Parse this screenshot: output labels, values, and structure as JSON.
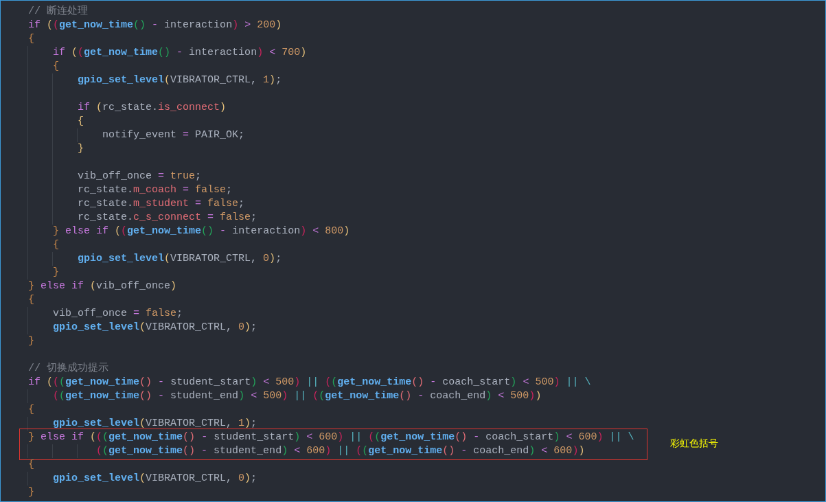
{
  "editor": {
    "lines": [
      {
        "kind": "code",
        "tokens": [
          {
            "kind": "cmt",
            "text": "// 断连处理"
          }
        ]
      },
      {
        "kind": "code",
        "tokens": [
          {
            "kind": "kw",
            "text": "if"
          },
          {
            "kind": "br1",
            "text": " ("
          },
          {
            "kind": "br2",
            "text": "("
          },
          {
            "kind": "fn",
            "text": "get_now_time"
          },
          {
            "kind": "br3",
            "text": "()"
          },
          {
            "kind": "op",
            "text": " -"
          },
          {
            "kind": "txt",
            "text": " interaction"
          },
          {
            "kind": "br2",
            "text": ")"
          },
          {
            "kind": "op",
            "text": " >"
          },
          {
            "kind": "num",
            "text": " 200"
          },
          {
            "kind": "br1",
            "text": ")"
          }
        ]
      },
      {
        "kind": "code",
        "tokens": [
          {
            "kind": "brace",
            "text": "{"
          }
        ]
      },
      {
        "kind": "code",
        "tokens": [
          {
            "kind": "kw",
            "text": "    if"
          },
          {
            "kind": "br1",
            "text": " ("
          },
          {
            "kind": "br2",
            "text": "("
          },
          {
            "kind": "fn",
            "text": "get_now_time"
          },
          {
            "kind": "br3",
            "text": "()"
          },
          {
            "kind": "op",
            "text": " -"
          },
          {
            "kind": "txt",
            "text": " interaction"
          },
          {
            "kind": "br2",
            "text": ")"
          },
          {
            "kind": "op",
            "text": " <"
          },
          {
            "kind": "num",
            "text": " 700"
          },
          {
            "kind": "br1",
            "text": ")"
          }
        ]
      },
      {
        "kind": "code",
        "tokens": [
          {
            "kind": "brace",
            "text": "    {"
          }
        ]
      },
      {
        "kind": "code",
        "tokens": [
          {
            "kind": "fn",
            "text": "        gpio_set_level"
          },
          {
            "kind": "br1",
            "text": "("
          },
          {
            "kind": "txt",
            "text": "VIBRATOR_CTRL,"
          },
          {
            "kind": "num",
            "text": " 1"
          },
          {
            "kind": "br1",
            "text": ")"
          },
          {
            "kind": "txt",
            "text": ";"
          }
        ]
      },
      {
        "kind": "blank"
      },
      {
        "kind": "code",
        "tokens": [
          {
            "kind": "kw",
            "text": "        if"
          },
          {
            "kind": "br1",
            "text": " ("
          },
          {
            "kind": "txt",
            "text": "rc_state."
          },
          {
            "kind": "mem",
            "text": "is_connect"
          },
          {
            "kind": "br1",
            "text": ")"
          }
        ]
      },
      {
        "kind": "code",
        "tokens": [
          {
            "kind": "br1",
            "text": "        {"
          }
        ]
      },
      {
        "kind": "code",
        "tokens": [
          {
            "kind": "txt",
            "text": "            notify_event"
          },
          {
            "kind": "op",
            "text": " ="
          },
          {
            "kind": "txt",
            "text": " PAIR_OK;"
          }
        ]
      },
      {
        "kind": "code",
        "tokens": [
          {
            "kind": "br1",
            "text": "        }"
          }
        ]
      },
      {
        "kind": "blank"
      },
      {
        "kind": "code",
        "tokens": [
          {
            "kind": "txt",
            "text": "        vib_off_once"
          },
          {
            "kind": "op",
            "text": " ="
          },
          {
            "kind": "num",
            "text": " true"
          },
          {
            "kind": "txt",
            "text": ";"
          }
        ]
      },
      {
        "kind": "code",
        "tokens": [
          {
            "kind": "txt",
            "text": "        rc_state."
          },
          {
            "kind": "mem",
            "text": "m_coach"
          },
          {
            "kind": "op",
            "text": " ="
          },
          {
            "kind": "num",
            "text": " false"
          },
          {
            "kind": "txt",
            "text": ";"
          }
        ]
      },
      {
        "kind": "code",
        "tokens": [
          {
            "kind": "txt",
            "text": "        rc_state."
          },
          {
            "kind": "mem",
            "text": "m_student"
          },
          {
            "kind": "op",
            "text": " ="
          },
          {
            "kind": "num",
            "text": " false"
          },
          {
            "kind": "txt",
            "text": ";"
          }
        ]
      },
      {
        "kind": "code",
        "tokens": [
          {
            "kind": "txt",
            "text": "        rc_state."
          },
          {
            "kind": "mem",
            "text": "c_s_connect"
          },
          {
            "kind": "op",
            "text": " ="
          },
          {
            "kind": "num",
            "text": " false"
          },
          {
            "kind": "txt",
            "text": ";"
          }
        ]
      },
      {
        "kind": "code",
        "tokens": [
          {
            "kind": "brace",
            "text": "    }"
          },
          {
            "kind": "kw",
            "text": " else if"
          },
          {
            "kind": "br1",
            "text": " ("
          },
          {
            "kind": "br2",
            "text": "("
          },
          {
            "kind": "fn",
            "text": "get_now_time"
          },
          {
            "kind": "br3",
            "text": "()"
          },
          {
            "kind": "op",
            "text": " -"
          },
          {
            "kind": "txt",
            "text": " interaction"
          },
          {
            "kind": "br2",
            "text": ")"
          },
          {
            "kind": "op",
            "text": " <"
          },
          {
            "kind": "num",
            "text": " 800"
          },
          {
            "kind": "br1",
            "text": ")"
          }
        ]
      },
      {
        "kind": "code",
        "tokens": [
          {
            "kind": "brace",
            "text": "    {"
          }
        ]
      },
      {
        "kind": "code",
        "tokens": [
          {
            "kind": "fn",
            "text": "        gpio_set_level"
          },
          {
            "kind": "br1",
            "text": "("
          },
          {
            "kind": "txt",
            "text": "VIBRATOR_CTRL,"
          },
          {
            "kind": "num",
            "text": " 0"
          },
          {
            "kind": "br1",
            "text": ")"
          },
          {
            "kind": "txt",
            "text": ";"
          }
        ]
      },
      {
        "kind": "code",
        "tokens": [
          {
            "kind": "brace",
            "text": "    }"
          }
        ]
      },
      {
        "kind": "code",
        "tokens": [
          {
            "kind": "brace",
            "text": "}"
          },
          {
            "kind": "kw",
            "text": " else if"
          },
          {
            "kind": "br1",
            "text": " ("
          },
          {
            "kind": "txt",
            "text": "vib_off_once"
          },
          {
            "kind": "br1",
            "text": ")"
          }
        ]
      },
      {
        "kind": "code",
        "tokens": [
          {
            "kind": "brace",
            "text": "{"
          }
        ]
      },
      {
        "kind": "code",
        "tokens": [
          {
            "kind": "txt",
            "text": "    vib_off_once"
          },
          {
            "kind": "op",
            "text": " ="
          },
          {
            "kind": "num",
            "text": " false"
          },
          {
            "kind": "txt",
            "text": ";"
          }
        ]
      },
      {
        "kind": "code",
        "tokens": [
          {
            "kind": "fn",
            "text": "    gpio_set_level"
          },
          {
            "kind": "br1",
            "text": "("
          },
          {
            "kind": "txt",
            "text": "VIBRATOR_CTRL,"
          },
          {
            "kind": "num",
            "text": " 0"
          },
          {
            "kind": "br1",
            "text": ")"
          },
          {
            "kind": "txt",
            "text": ";"
          }
        ]
      },
      {
        "kind": "code",
        "tokens": [
          {
            "kind": "brace",
            "text": "}"
          }
        ]
      },
      {
        "kind": "blank"
      },
      {
        "kind": "code",
        "tokens": [
          {
            "kind": "cmt",
            "text": "// 切换成功提示"
          }
        ]
      },
      {
        "kind": "code",
        "tokens": [
          {
            "kind": "kw",
            "text": "if"
          },
          {
            "kind": "br1",
            "text": " ("
          },
          {
            "kind": "br2",
            "text": "("
          },
          {
            "kind": "br3",
            "text": "("
          },
          {
            "kind": "fn",
            "text": "get_now_time"
          },
          {
            "kind": "br4",
            "text": "()"
          },
          {
            "kind": "op",
            "text": " -"
          },
          {
            "kind": "txt",
            "text": " student_start"
          },
          {
            "kind": "br3",
            "text": ")"
          },
          {
            "kind": "op",
            "text": " <"
          },
          {
            "kind": "num",
            "text": " 500"
          },
          {
            "kind": "br2",
            "text": ")"
          },
          {
            "kind": "or",
            "text": " ||"
          },
          {
            "kind": "br2",
            "text": " ("
          },
          {
            "kind": "br3",
            "text": "("
          },
          {
            "kind": "fn",
            "text": "get_now_time"
          },
          {
            "kind": "br4",
            "text": "()"
          },
          {
            "kind": "op",
            "text": " -"
          },
          {
            "kind": "txt",
            "text": " coach_start"
          },
          {
            "kind": "br3",
            "text": ")"
          },
          {
            "kind": "op",
            "text": " <"
          },
          {
            "kind": "num",
            "text": " 500"
          },
          {
            "kind": "br2",
            "text": ")"
          },
          {
            "kind": "or",
            "text": " || \\"
          }
        ]
      },
      {
        "kind": "code",
        "tokens": [
          {
            "kind": "br2",
            "text": "    ("
          },
          {
            "kind": "br3",
            "text": "("
          },
          {
            "kind": "fn",
            "text": "get_now_time"
          },
          {
            "kind": "br4",
            "text": "()"
          },
          {
            "kind": "op",
            "text": " -"
          },
          {
            "kind": "txt",
            "text": " student_end"
          },
          {
            "kind": "br3",
            "text": ")"
          },
          {
            "kind": "op",
            "text": " <"
          },
          {
            "kind": "num",
            "text": " 500"
          },
          {
            "kind": "br2",
            "text": ")"
          },
          {
            "kind": "or",
            "text": " ||"
          },
          {
            "kind": "br2",
            "text": " ("
          },
          {
            "kind": "br3",
            "text": "("
          },
          {
            "kind": "fn",
            "text": "get_now_time"
          },
          {
            "kind": "br4",
            "text": "()"
          },
          {
            "kind": "op",
            "text": " -"
          },
          {
            "kind": "txt",
            "text": " coach_end"
          },
          {
            "kind": "br3",
            "text": ")"
          },
          {
            "kind": "op",
            "text": " <"
          },
          {
            "kind": "num",
            "text": " 500"
          },
          {
            "kind": "br2",
            "text": ")"
          },
          {
            "kind": "br1",
            "text": ")"
          }
        ]
      },
      {
        "kind": "code",
        "tokens": [
          {
            "kind": "brace",
            "text": "{"
          }
        ]
      },
      {
        "kind": "code",
        "tokens": [
          {
            "kind": "fn",
            "text": "    gpio_set_level"
          },
          {
            "kind": "br1",
            "text": "("
          },
          {
            "kind": "txt",
            "text": "VIBRATOR_CTRL,"
          },
          {
            "kind": "num",
            "text": " 1"
          },
          {
            "kind": "br1",
            "text": ")"
          },
          {
            "kind": "txt",
            "text": ";"
          }
        ]
      },
      {
        "kind": "code",
        "highlighted": true,
        "tokens": [
          {
            "kind": "brace",
            "text": "}"
          },
          {
            "kind": "kw",
            "text": " else if"
          },
          {
            "kind": "br1",
            "text": " ("
          },
          {
            "kind": "br2",
            "text": "("
          },
          {
            "kind": "br3",
            "text": "("
          },
          {
            "kind": "fn",
            "text": "get_now_time"
          },
          {
            "kind": "br4",
            "text": "()"
          },
          {
            "kind": "op",
            "text": " -"
          },
          {
            "kind": "txt",
            "text": " student_start"
          },
          {
            "kind": "br3",
            "text": ")"
          },
          {
            "kind": "op",
            "text": " <"
          },
          {
            "kind": "num",
            "text": " 600"
          },
          {
            "kind": "br2",
            "text": ")"
          },
          {
            "kind": "or",
            "text": " ||"
          },
          {
            "kind": "br2",
            "text": " ("
          },
          {
            "kind": "br3",
            "text": "("
          },
          {
            "kind": "fn",
            "text": "get_now_time"
          },
          {
            "kind": "br4",
            "text": "()"
          },
          {
            "kind": "op",
            "text": " -"
          },
          {
            "kind": "txt",
            "text": " coach_start"
          },
          {
            "kind": "br3",
            "text": ")"
          },
          {
            "kind": "op",
            "text": " <"
          },
          {
            "kind": "num",
            "text": " 600"
          },
          {
            "kind": "br2",
            "text": ")"
          },
          {
            "kind": "or",
            "text": " || \\"
          }
        ]
      },
      {
        "kind": "code",
        "highlighted": true,
        "tokens": [
          {
            "kind": "br2",
            "text": "           ("
          },
          {
            "kind": "br3",
            "text": "("
          },
          {
            "kind": "fn",
            "text": "get_now_time"
          },
          {
            "kind": "br4",
            "text": "()"
          },
          {
            "kind": "op",
            "text": " -"
          },
          {
            "kind": "txt",
            "text": " student_end"
          },
          {
            "kind": "br3",
            "text": ")"
          },
          {
            "kind": "op",
            "text": " <"
          },
          {
            "kind": "num",
            "text": " 600"
          },
          {
            "kind": "br2",
            "text": ")"
          },
          {
            "kind": "or",
            "text": " ||"
          },
          {
            "kind": "br2",
            "text": " ("
          },
          {
            "kind": "br3",
            "text": "("
          },
          {
            "kind": "fn",
            "text": "get_now_time"
          },
          {
            "kind": "br4",
            "text": "()"
          },
          {
            "kind": "op",
            "text": " -"
          },
          {
            "kind": "txt",
            "text": " coach_end"
          },
          {
            "kind": "br3",
            "text": ")"
          },
          {
            "kind": "op",
            "text": " <"
          },
          {
            "kind": "num",
            "text": " 600"
          },
          {
            "kind": "br2",
            "text": ")"
          },
          {
            "kind": "br1",
            "text": ")"
          }
        ]
      },
      {
        "kind": "code",
        "tokens": [
          {
            "kind": "brace",
            "text": "{"
          }
        ]
      },
      {
        "kind": "code",
        "tokens": [
          {
            "kind": "fn",
            "text": "    gpio_set_level"
          },
          {
            "kind": "br1",
            "text": "("
          },
          {
            "kind": "txt",
            "text": "VIBRATOR_CTRL,"
          },
          {
            "kind": "num",
            "text": " 0"
          },
          {
            "kind": "br1",
            "text": ")"
          },
          {
            "kind": "txt",
            "text": ";"
          }
        ]
      },
      {
        "kind": "code",
        "tokens": [
          {
            "kind": "brace",
            "text": "}"
          }
        ]
      }
    ]
  },
  "annotation": {
    "text": "彩虹色括号"
  }
}
